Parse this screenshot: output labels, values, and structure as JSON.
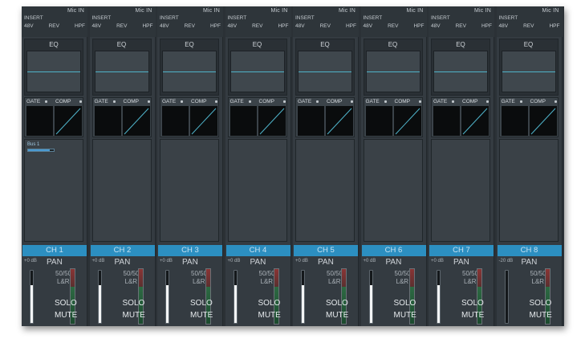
{
  "channels": [
    {
      "mic": "Mic IN",
      "insert": "INSERT",
      "phantom": "48V",
      "rev": "REV",
      "hpf": "HPF",
      "eq": "EQ",
      "gate": "GATE",
      "comp": "COMP",
      "bus": "Bus 1",
      "bus_level": 0.85,
      "name": "CH 1",
      "gain": "+0 dB",
      "pan": "PAN",
      "pan_value": "50/50",
      "pan_dir": "L&R",
      "solo": "SOLO",
      "mute": "MUTE",
      "fader_level": 0.72
    },
    {
      "mic": "Mic IN",
      "insert": "INSERT",
      "phantom": "48V",
      "rev": "REV",
      "hpf": "HPF",
      "eq": "EQ",
      "gate": "GATE",
      "comp": "COMP",
      "bus": "",
      "bus_level": 0,
      "name": "CH 2",
      "gain": "+0 dB",
      "pan": "PAN",
      "pan_value": "50/50",
      "pan_dir": "L&R",
      "solo": "SOLO",
      "mute": "MUTE",
      "fader_level": 0.72
    },
    {
      "mic": "Mic IN",
      "insert": "INSERT",
      "phantom": "48V",
      "rev": "REV",
      "hpf": "HPF",
      "eq": "EQ",
      "gate": "GATE",
      "comp": "COMP",
      "bus": "",
      "bus_level": 0,
      "name": "CH 3",
      "gain": "+0 dB",
      "pan": "PAN",
      "pan_value": "50/50",
      "pan_dir": "L&R",
      "solo": "SOLO",
      "mute": "MUTE",
      "fader_level": 0.72
    },
    {
      "mic": "Mic IN",
      "insert": "INSERT",
      "phantom": "48V",
      "rev": "REV",
      "hpf": "HPF",
      "eq": "EQ",
      "gate": "GATE",
      "comp": "COMP",
      "bus": "",
      "bus_level": 0,
      "name": "CH 4",
      "gain": "+0 dB",
      "pan": "PAN",
      "pan_value": "50/50",
      "pan_dir": "L&R",
      "solo": "SOLO",
      "mute": "MUTE",
      "fader_level": 0.72
    },
    {
      "mic": "Mic IN",
      "insert": "INSERT",
      "phantom": "48V",
      "rev": "REV",
      "hpf": "HPF",
      "eq": "EQ",
      "gate": "GATE",
      "comp": "COMP",
      "bus": "",
      "bus_level": 0,
      "name": "CH 5",
      "gain": "+0 dB",
      "pan": "PAN",
      "pan_value": "50/50",
      "pan_dir": "L&R",
      "solo": "SOLO",
      "mute": "MUTE",
      "fader_level": 0.72
    },
    {
      "mic": "Mic IN",
      "insert": "INSERT",
      "phantom": "48V",
      "rev": "REV",
      "hpf": "HPF",
      "eq": "EQ",
      "gate": "GATE",
      "comp": "COMP",
      "bus": "",
      "bus_level": 0,
      "name": "CH 6",
      "gain": "+0 dB",
      "pan": "PAN",
      "pan_value": "50/50",
      "pan_dir": "L&R",
      "solo": "SOLO",
      "mute": "MUTE",
      "fader_level": 0.72
    },
    {
      "mic": "Mic IN",
      "insert": "INSERT",
      "phantom": "48V",
      "rev": "REV",
      "hpf": "HPF",
      "eq": "EQ",
      "gate": "GATE",
      "comp": "COMP",
      "bus": "",
      "bus_level": 0,
      "name": "CH 7",
      "gain": "+0 dB",
      "pan": "PAN",
      "pan_value": "50/50",
      "pan_dir": "L&R",
      "solo": "SOLO",
      "mute": "MUTE",
      "fader_level": 0.72
    },
    {
      "mic": "Mic IN",
      "insert": "INSERT",
      "phantom": "48V",
      "rev": "REV",
      "hpf": "HPF",
      "eq": "EQ",
      "gate": "GATE",
      "comp": "COMP",
      "bus": "",
      "bus_level": 0,
      "name": "CH 8",
      "gain": "-20 dB",
      "pan": "PAN",
      "pan_value": "50/50",
      "pan_dir": "L&R",
      "solo": "SOLO",
      "mute": "MUTE",
      "fader_level": 0.0
    }
  ],
  "colors": {
    "accent": "#2c8fc1",
    "eq_curve": "#4fb3c9",
    "comp_curve": "#4fb3c9",
    "meter_green": "#2d6a43",
    "meter_red": "#8a3434"
  }
}
